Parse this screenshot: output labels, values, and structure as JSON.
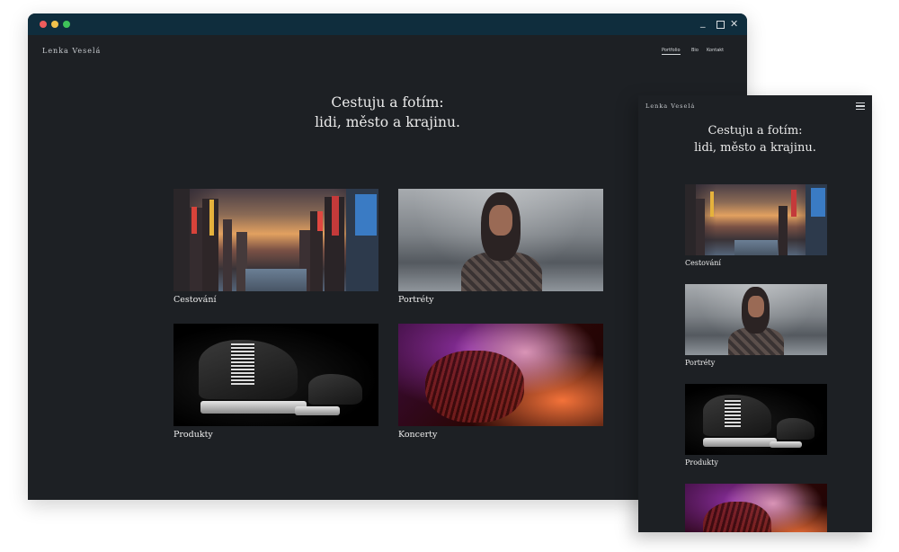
{
  "colors": {
    "accent_close": "#ee5c5c",
    "accent_min": "#f2c24c",
    "accent_max": "#3fc35a",
    "titlebar": "#0f2d3d",
    "page_bg": "#1d2024"
  },
  "desktop": {
    "brand": "Lenka Veselá",
    "nav": [
      {
        "label": "Portfolio"
      },
      {
        "label": "Bio"
      },
      {
        "label": "Kontakt"
      }
    ],
    "hero_line1": "Cestuju a fotím:",
    "hero_line2": "lidi, město a krajinu.",
    "cards": [
      {
        "label": "Cestování",
        "image_icon": "city-photo"
      },
      {
        "label": "Portréty",
        "image_icon": "portrait-photo"
      },
      {
        "label": "Produkty",
        "image_icon": "skate-photo"
      },
      {
        "label": "Koncerty",
        "image_icon": "concert-photo"
      }
    ]
  },
  "mobile": {
    "brand": "Lenka Veselá",
    "menu_icon": "hamburger-icon",
    "hero_line1": "Cestuju a fotím:",
    "hero_line2": "lidi, město a krajinu.",
    "cards": [
      {
        "label": "Cestování"
      },
      {
        "label": "Portréty"
      },
      {
        "label": "Produkty"
      },
      {
        "label": ""
      }
    ]
  }
}
